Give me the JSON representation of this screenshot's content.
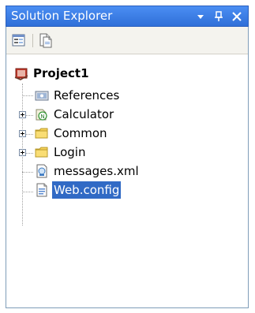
{
  "window": {
    "title": "Solution Explorer",
    "dropdown_glyph": "▾",
    "pin_glyph": "ᵽ",
    "close_glyph": "✕"
  },
  "toolbar": {
    "buttons": [
      {
        "name": "properties",
        "icon": "properties-icon"
      },
      {
        "name": "show-all-files",
        "icon": "show-all-files-icon"
      }
    ]
  },
  "tree": {
    "root": {
      "label": "Project1",
      "icon": "project-icon"
    },
    "items": [
      {
        "label": "References",
        "icon": "references-icon",
        "expandable": false
      },
      {
        "label": "Calculator",
        "icon": "namespace-icon",
        "expandable": true
      },
      {
        "label": "Common",
        "icon": "folder-icon",
        "expandable": true
      },
      {
        "label": "Login",
        "icon": "folder-icon",
        "expandable": true
      },
      {
        "label": "messages.xml",
        "icon": "xml-file-icon",
        "expandable": false
      },
      {
        "label": "Web.config",
        "icon": "config-file-icon",
        "expandable": false,
        "selected": true
      }
    ]
  },
  "colors": {
    "title_bar": "#2f6fd8",
    "selection": "#316ac5",
    "folder": "#f6d25a"
  }
}
